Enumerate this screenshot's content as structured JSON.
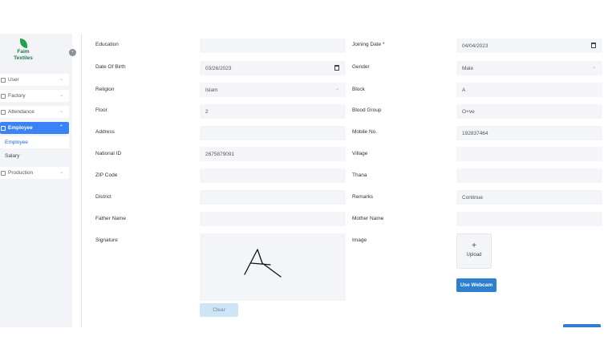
{
  "brand": {
    "line1": "Faim",
    "line2": "Textiles"
  },
  "sidebar": {
    "items": [
      {
        "label": "User"
      },
      {
        "label": "Factory"
      },
      {
        "label": "Attendance"
      },
      {
        "label": "Employee"
      },
      {
        "label": "Production"
      }
    ],
    "submenu": [
      {
        "label": "Employee"
      },
      {
        "label": "Salary"
      }
    ]
  },
  "form": {
    "education_label": "Education",
    "joining_date_label": "Joining Date *",
    "joining_date_value": "04/04/2023",
    "dob_label": "Date Of Birth",
    "dob_value": "03/26/2023",
    "gender_label": "Gender",
    "gender_value": "Male",
    "religion_label": "Religion",
    "religion_value": "Islam",
    "block_label": "Block",
    "block_value": "A",
    "floor_label": "Floor",
    "floor_value": "2",
    "blood_group_label": "Blood Group",
    "blood_group_value": "O+ve",
    "address_label": "Address",
    "mobile_label": "Mobile No.",
    "mobile_value": "192837464",
    "national_id_label": "National ID",
    "national_id_value": "2675879091",
    "village_label": "Village",
    "zip_label": "ZIP Code",
    "thana_label": "Thana",
    "district_label": "District",
    "remarks_label": "Remarks",
    "remarks_value": "Continue",
    "father_label": "Father Name",
    "mother_label": "Mother Name",
    "signature_label": "Signature",
    "image_label": "Image",
    "clear_button": "Clear",
    "upload_label": "Upload",
    "webcam_button": "Use Webcam"
  },
  "colors": {
    "accent": "#3b82f6",
    "brand_green": "#22a04a",
    "field_bg": "#f3f5f8"
  }
}
